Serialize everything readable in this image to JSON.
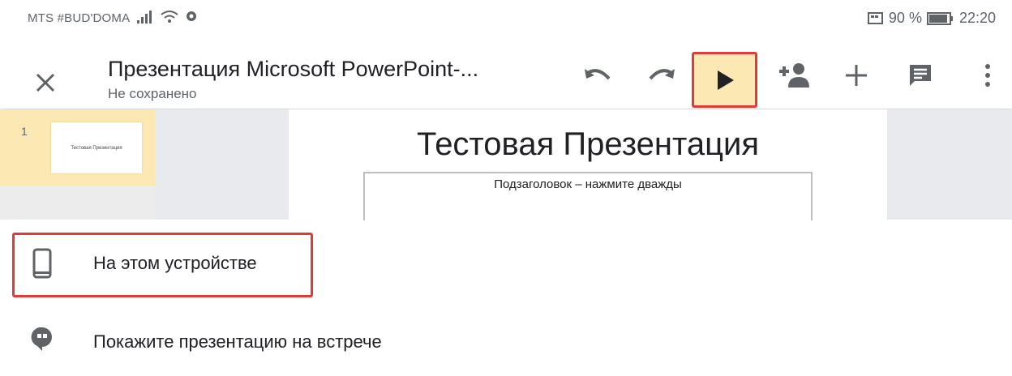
{
  "status_bar": {
    "carrier": "MTS #BUD'DOMA",
    "battery": "90 %",
    "time": "22:20"
  },
  "app_bar": {
    "title": "Презентация Microsoft PowerPoint-...",
    "save_status": "Не сохранено"
  },
  "thumbnails": [
    {
      "number": "1",
      "text": "Тестовая Презентация"
    }
  ],
  "slide": {
    "title": "Тестовая Презентация",
    "subtitle": "Подзаголовок – нажмите дважды"
  },
  "present_options": [
    {
      "label": "На этом устройстве",
      "icon": "phone-icon"
    },
    {
      "label": "Покажите презентацию на встрече",
      "icon": "hangouts-icon"
    }
  ],
  "colors": {
    "highlight": "#e53935",
    "active": "#fce8b2"
  }
}
